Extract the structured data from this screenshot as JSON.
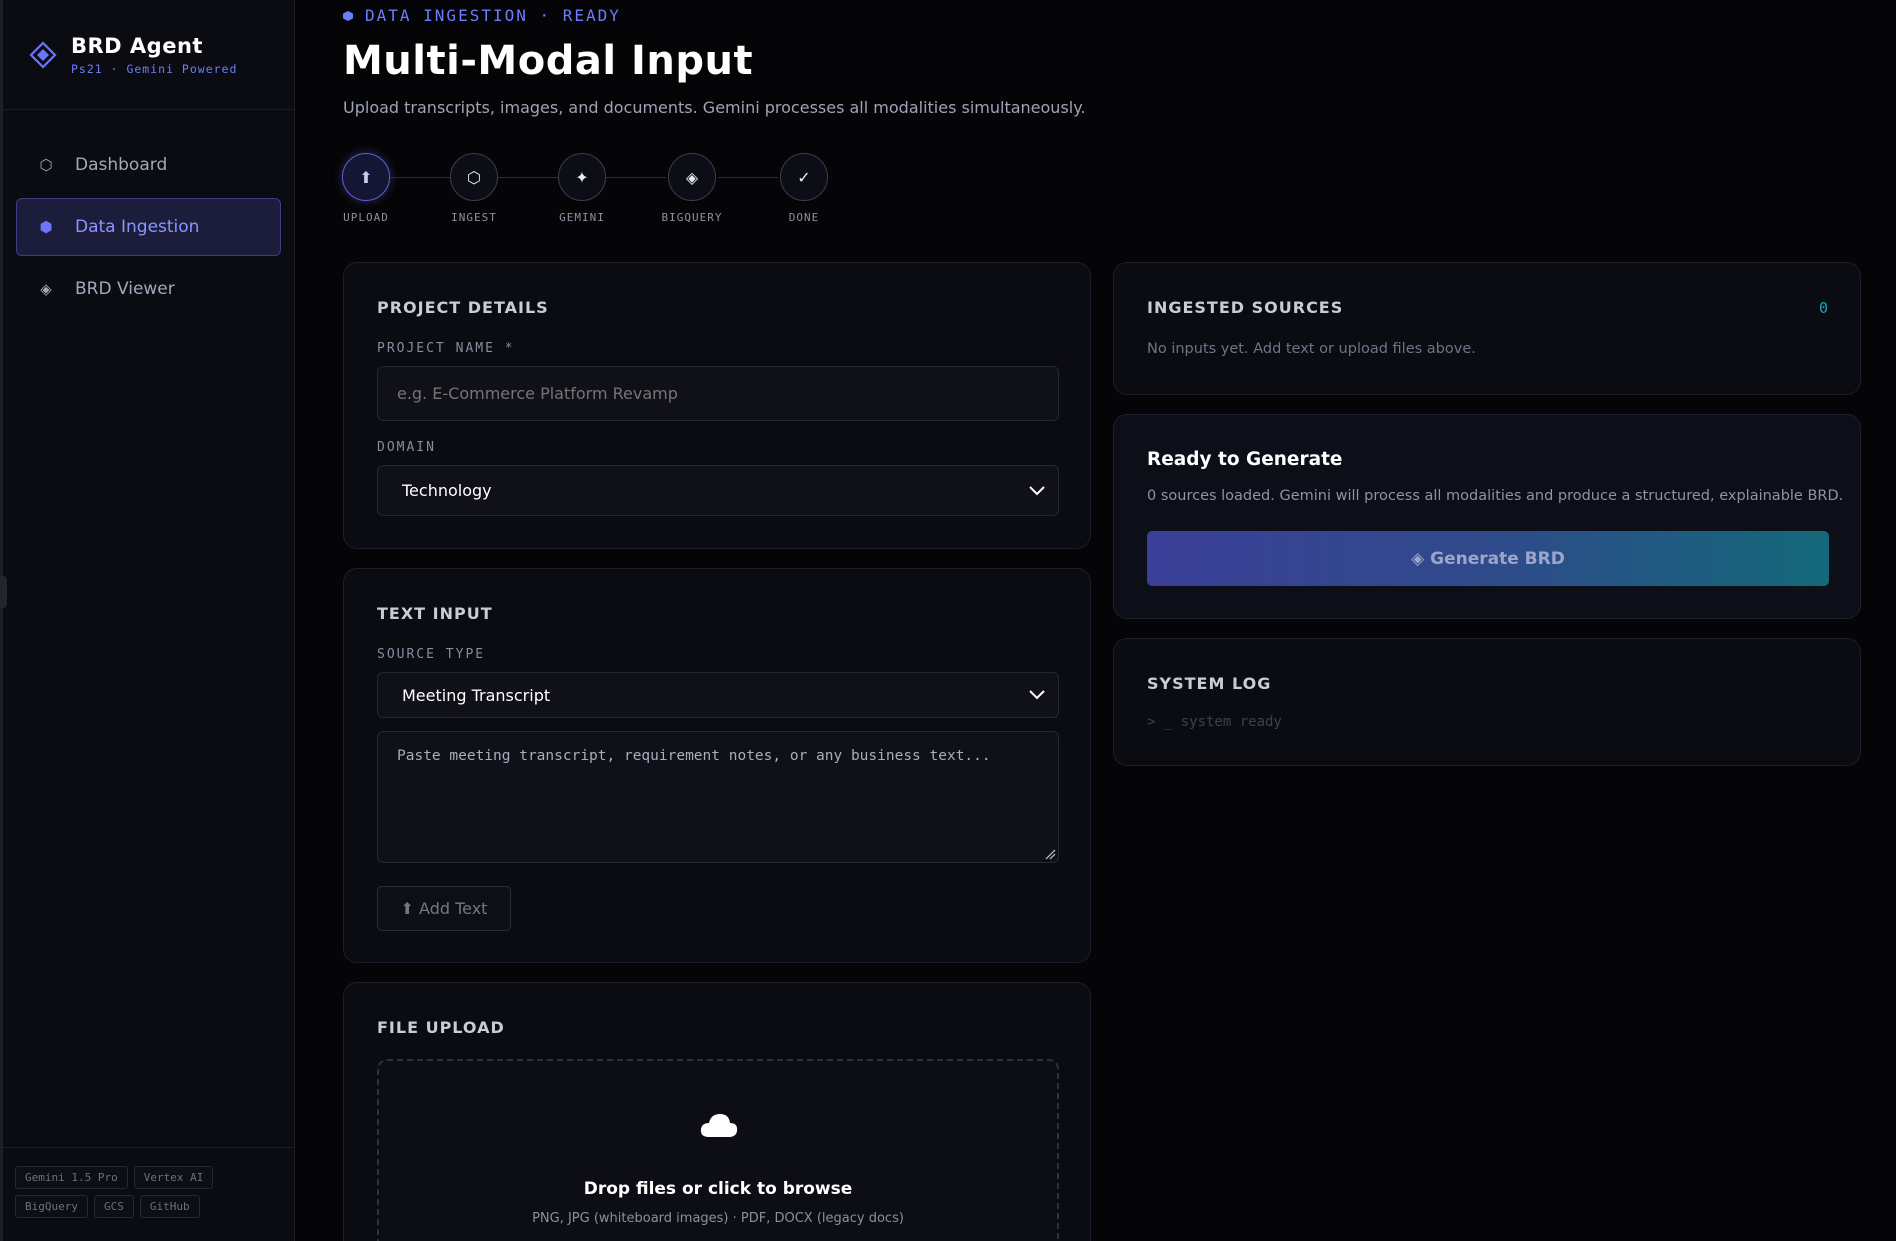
{
  "sidebar": {
    "brand_title": "BRD Agent",
    "brand_subtitle": "Ps21 · Gemini Powered",
    "items": [
      {
        "label": "Dashboard",
        "icon": "hexagon-outline-icon"
      },
      {
        "label": "Data Ingestion",
        "icon": "hexagon-filled-icon"
      },
      {
        "label": "BRD Viewer",
        "icon": "diamond-icon"
      }
    ],
    "tags_row1": [
      "Gemini 1.5 Pro",
      "Vertex AI"
    ],
    "tags_row2": [
      "BigQuery",
      "GCS",
      "GitHub"
    ]
  },
  "header": {
    "status": "DATA INGESTION · READY",
    "title": "Multi-Modal Input",
    "subtitle": "Upload transcripts, images, and documents. Gemini processes all modalities simultaneously."
  },
  "steps": [
    {
      "label": "UPLOAD",
      "glyph": "⬆",
      "icon": "upload-arrow-icon"
    },
    {
      "label": "INGEST",
      "glyph": "⬡",
      "icon": "hexagon-icon"
    },
    {
      "label": "GEMINI",
      "glyph": "✦",
      "icon": "sparkle-icon"
    },
    {
      "label": "BIGQUERY",
      "glyph": "◈",
      "icon": "diamond-icon"
    },
    {
      "label": "DONE",
      "glyph": "✓",
      "icon": "check-icon"
    }
  ],
  "project": {
    "title": "PROJECT DETAILS",
    "name_label": "PROJECT NAME *",
    "name_placeholder": "e.g. E-Commerce Platform Revamp",
    "domain_label": "DOMAIN",
    "domain_value": "Technology"
  },
  "text_input": {
    "title": "TEXT INPUT",
    "source_label": "SOURCE TYPE",
    "source_value": "Meeting Transcript",
    "placeholder": "Paste meeting transcript, requirement notes, or any business text...",
    "add_button": "⬆ Add Text"
  },
  "file_upload": {
    "title": "FILE UPLOAD",
    "drop_title": "Drop files or click to browse",
    "drop_hint": "PNG, JPG (whiteboard images) · PDF, DOCX (legacy docs)"
  },
  "sources": {
    "title": "INGESTED SOURCES",
    "count": "0",
    "empty": "No inputs yet. Add text or upload files above."
  },
  "generate": {
    "title": "Ready to Generate",
    "desc": "0 sources loaded. Gemini will process all modalities and produce a structured, explainable BRD.",
    "button": "◈ Generate BRD"
  },
  "log": {
    "title": "SYSTEM LOG",
    "line": "> _ system ready"
  },
  "colors": {
    "accent": "#6b7cff",
    "background": "#050507",
    "card": "#0b0c12",
    "teal": "#13697a"
  }
}
